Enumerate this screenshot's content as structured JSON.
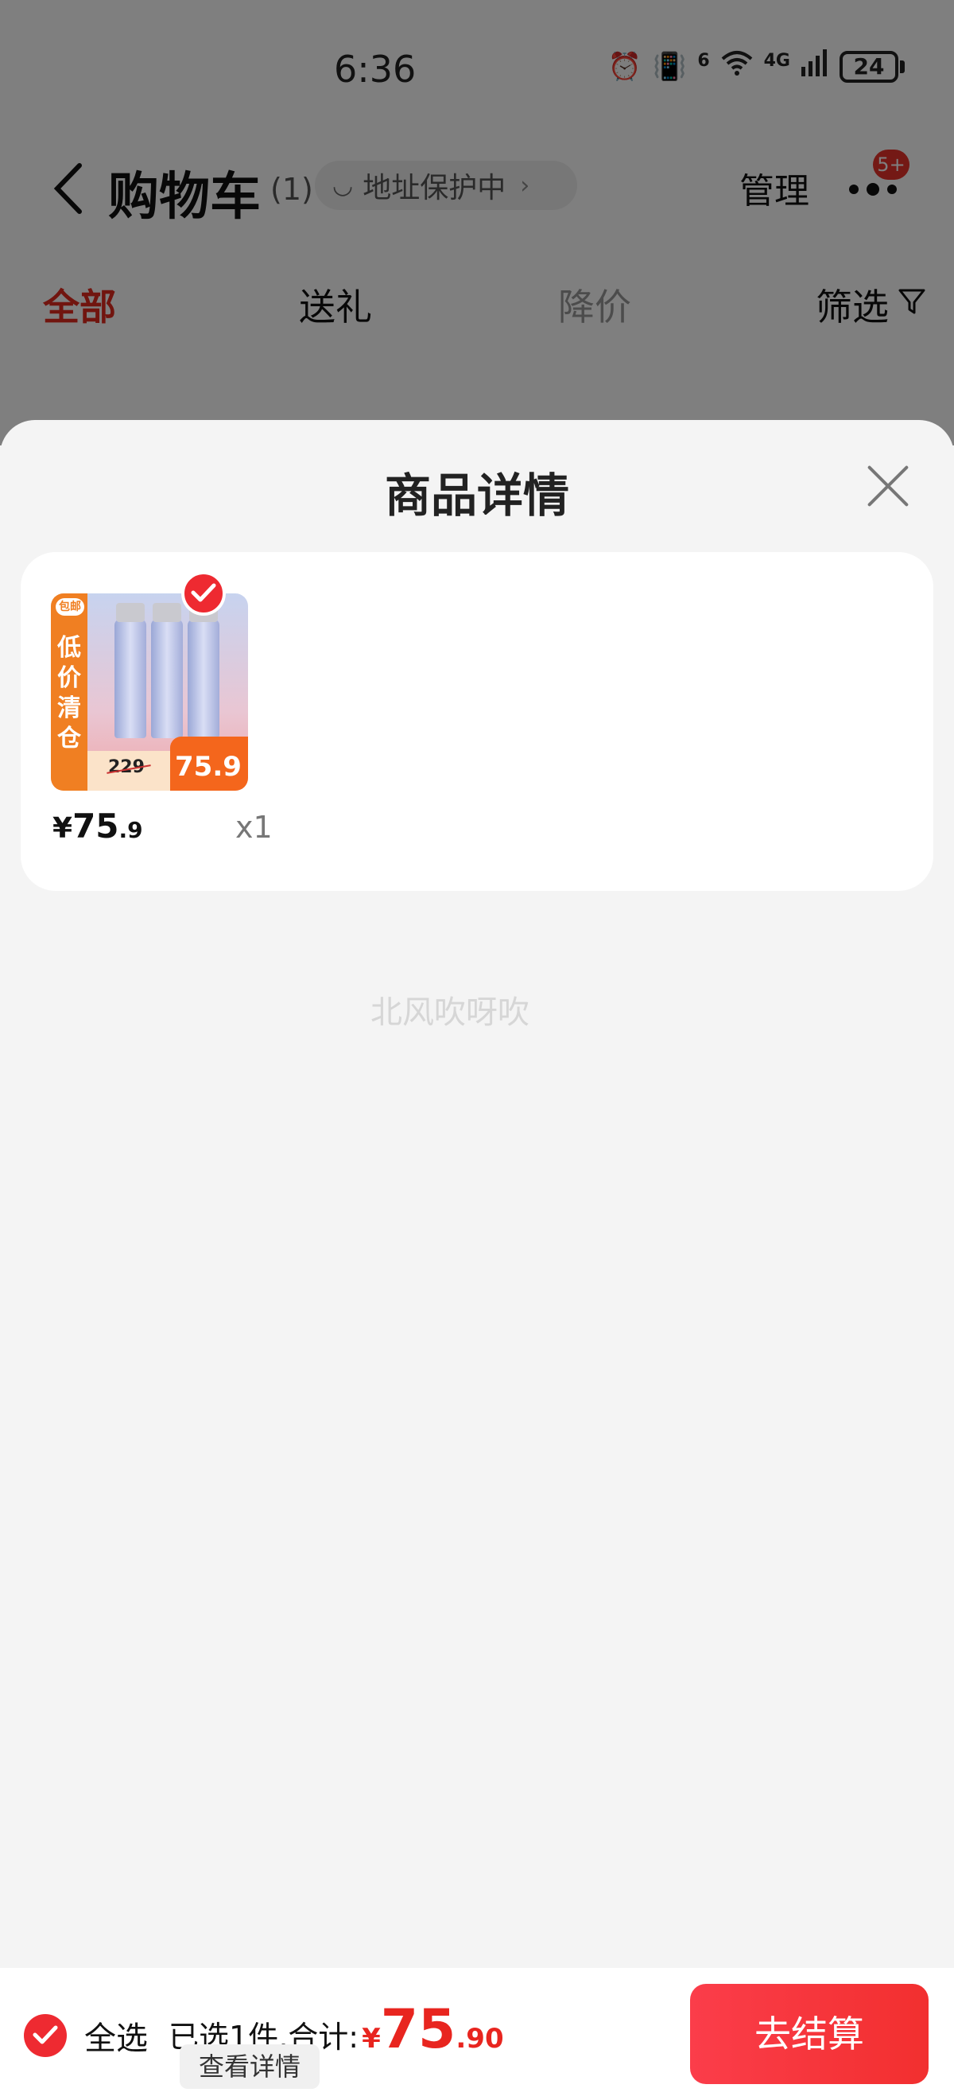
{
  "status_bar": {
    "time": "6:36",
    "network_label": "4G",
    "wifi_label": "6",
    "battery": "24"
  },
  "header": {
    "back_icon": "chevron-left-icon",
    "title": "购物车",
    "count": "(1)",
    "address_protection": "地址保护中",
    "manage_label": "管理",
    "more_icon": "more-dots-icon",
    "notification_badge": "5+"
  },
  "tabs": [
    {
      "label": "全部",
      "active": true
    },
    {
      "label": "送礼",
      "active": false
    },
    {
      "label": "降价",
      "active": false
    }
  ],
  "filter": {
    "label": "筛选",
    "icon": "filter-icon"
  },
  "sheet": {
    "title": "商品详情",
    "close_icon": "close-icon",
    "product": {
      "thumbnail": {
        "tag": "包邮",
        "side_text": "低价清仓",
        "original_price": "229",
        "price": "75.9"
      },
      "checked": true,
      "price_symbol": "¥",
      "price_int": "75",
      "price_dec": ".9",
      "quantity": "x1"
    },
    "watermark": "北风吹呀吹"
  },
  "bottom_bar": {
    "select_all_label": "全选",
    "summary_text": "已选1件,合计:",
    "total_symbol": "¥",
    "total_int": "75",
    "total_dec": ".90",
    "detail_label": "查看详情",
    "checkout_label": "去结算"
  },
  "colors": {
    "accent_red": "#e8251f",
    "checkout_red": "#f22f2f",
    "thumb_orange": "#f07f22"
  }
}
